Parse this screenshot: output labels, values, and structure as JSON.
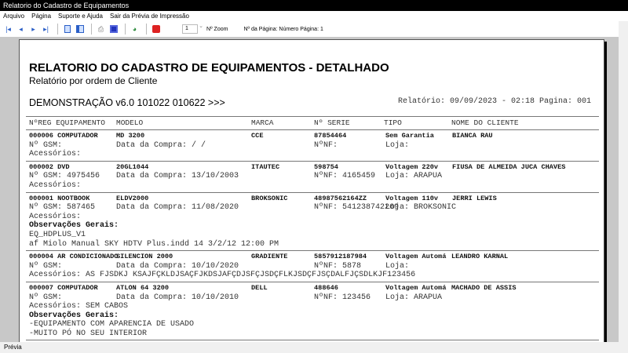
{
  "window": {
    "title": "Relatorio do Cadastro de Equipamentos"
  },
  "menu": [
    "Arquivo",
    "Página",
    "Suporte e Ajuda",
    "Sair da Prévia de Impressão"
  ],
  "toolbar": {
    "zoom_value": "1",
    "zoom_label": "Nº Zoom",
    "page_label": "Nº da Página: Número Página: 1",
    "icons": [
      "first-page-icon",
      "prev-page-icon",
      "next-page-icon",
      "last-page-icon",
      "single-page-icon",
      "two-page-icon",
      "print-icon",
      "save-icon",
      "export-icon",
      "close-icon"
    ]
  },
  "report": {
    "title": "RELATORIO DO CADASTRO DE EQUIPAMENTOS - DETALHADO",
    "subtitle": "Relatório por ordem de Cliente",
    "demo": "DEMONSTRAÇÃO v6.0 101022 010622 >>>",
    "info": "Relatório: 09/09/2023 - 02:18  Pagina: 001",
    "columns": [
      "NºREG EQUIPAMENTO",
      "MODELO",
      "MARCA",
      "Nº SERIE",
      "TIPO",
      "NOME DO CLIENTE"
    ],
    "records": [
      {
        "reg": "000006",
        "equip": "COMPUTADOR",
        "modelo": "MD 3200",
        "marca": "CCE",
        "serie": "87854464",
        "tipo": "Sem Garantia",
        "cliente": "BIANCA RAU",
        "gsm": "Nº GSM:",
        "compra": "Data da Compra:   /  /",
        "nf": "NºNF:",
        "loja": "Loja:",
        "acess": "Acessórios:",
        "obs": []
      },
      {
        "reg": "000002",
        "equip": "DVD",
        "modelo": "20GL1044",
        "marca": "ITAUTEC",
        "serie": "598754",
        "tipo": "Voltagem 220v",
        "cliente": "FIUSA DE ALMEIDA JUCA CHAVES",
        "gsm": "Nº GSM: 4975456",
        "compra": "Data da Compra: 13/10/2003",
        "nf": "NºNF: 4165459",
        "loja": "Loja: ARAPUA",
        "acess": "Acessórios:",
        "obs": []
      },
      {
        "reg": "000001",
        "equip": "NOOTBOOK",
        "modelo": "ELDV2000",
        "marca": "BROKSONIC",
        "serie": "48987562164ZZ",
        "tipo": "Voltagem 110v",
        "cliente": "JERRI LEWIS",
        "gsm": "Nº GSM: 587465",
        "compra": "Data da Compra: 11/08/2020",
        "nf": "NºNF: 541238742269",
        "loja": "Loja: BROKSONIC",
        "acess": "Acessórios:",
        "obs_label": "Observações Gerais:",
        "obs": [
          "EQ_HDPLUS_V1",
          "af Miolo Manual SKY HDTV Plus.indd 14 3/2/12 12:00 PM"
        ]
      },
      {
        "reg": "000004",
        "equip": "AR CONDICIONADO",
        "modelo": "SILENCION 2000",
        "marca": "GRADIENTE",
        "serie": "5857912187984",
        "tipo": "Voltagem Automá",
        "cliente": "LEANDRO KARNAL",
        "gsm": "Nº GSM:",
        "compra": "Data da Compra: 10/10/2020",
        "nf": "NºNF: 5878",
        "loja": "Loja:",
        "acess": "Acessórios: AS FJSDKJ KSAJFÇKLDJSAÇFJKDSJAFÇDJSFÇJSDÇFLKJSDÇFJSÇDALFJÇSDLKJF123456",
        "obs": []
      },
      {
        "reg": "000007",
        "equip": "COMPUTADOR",
        "modelo": "ATLON 64 3200",
        "marca": "DELL",
        "serie": "488646",
        "tipo": "Voltagem Automá",
        "cliente": "MACHADO DE ASSIS",
        "gsm": "Nº GSM:",
        "compra": "Data da Compra: 10/10/2010",
        "nf": "NºNF: 123456",
        "loja": "Loja: ARAPUA",
        "acess": "Acessórios: SEM CABOS",
        "obs_label": "Observações Gerais:",
        "obs": [
          "-EQUIPAMENTO COM APARENCIA DE USADO",
          "-MUITO PÓ NO SEU INTERIOR"
        ]
      }
    ]
  },
  "status": {
    "text": "Prévia"
  }
}
